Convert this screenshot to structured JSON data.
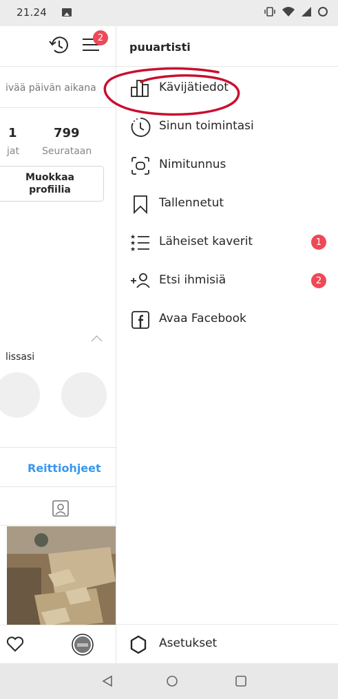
{
  "status_bar": {
    "time": "21.24"
  },
  "profile": {
    "bio_snippet": "ivää päivän aikana",
    "stat_left_number": "1",
    "stat_left_label": "jat",
    "following_count": "799",
    "following_label": "Seurataan",
    "edit_profile_label": "Muokkaa profiilia",
    "highlights_label": "lissasi",
    "directions_label": "Reittiohjeet",
    "menu_badge": "2"
  },
  "drawer": {
    "username": "puuartisti",
    "items": [
      {
        "label": "Kävijätiedot",
        "icon": "insights-icon"
      },
      {
        "label": "Sinun toimintasi",
        "icon": "activity-icon"
      },
      {
        "label": "Nimitunnus",
        "icon": "nametag-icon"
      },
      {
        "label": "Tallennetut",
        "icon": "bookmark-icon"
      },
      {
        "label": "Läheiset kaverit",
        "icon": "close-friends-icon",
        "badge": "1"
      },
      {
        "label": "Etsi ihmisiä",
        "icon": "add-person-icon",
        "badge": "2"
      },
      {
        "label": "Avaa Facebook",
        "icon": "facebook-icon"
      }
    ],
    "settings_label": "Asetukset"
  },
  "colors": {
    "badge": "#ed4956",
    "link": "#3897f0",
    "annotation": "#c8102e"
  }
}
